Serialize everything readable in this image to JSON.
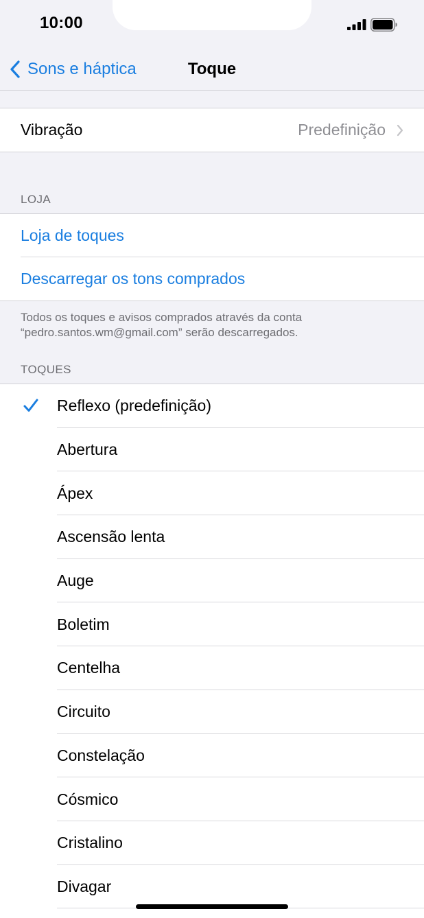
{
  "status_bar": {
    "time": "10:00"
  },
  "nav": {
    "back_label": "Sons e háptica",
    "title": "Toque"
  },
  "vibration": {
    "label": "Vibração",
    "value": "Predefinição"
  },
  "store": {
    "header": "LOJA",
    "items": [
      "Loja de toques",
      "Descarregar os tons comprados"
    ],
    "footer": "Todos os toques e avisos comprados através da conta “pedro.santos.wm@gmail.com” serão descarregados."
  },
  "ringtones": {
    "header": "TOQUES",
    "selected_index": 0,
    "items": [
      "Reflexo (predefinição)",
      "Abertura",
      "Ápex",
      "Ascensão lenta",
      "Auge",
      "Boletim",
      "Centelha",
      "Circuito",
      "Constelação",
      "Cósmico",
      "Cristalino",
      "Divagar"
    ]
  },
  "colors": {
    "accent": "#1a7ee0",
    "background": "#f2f2f7",
    "secondary_text": "#8e8e93"
  }
}
